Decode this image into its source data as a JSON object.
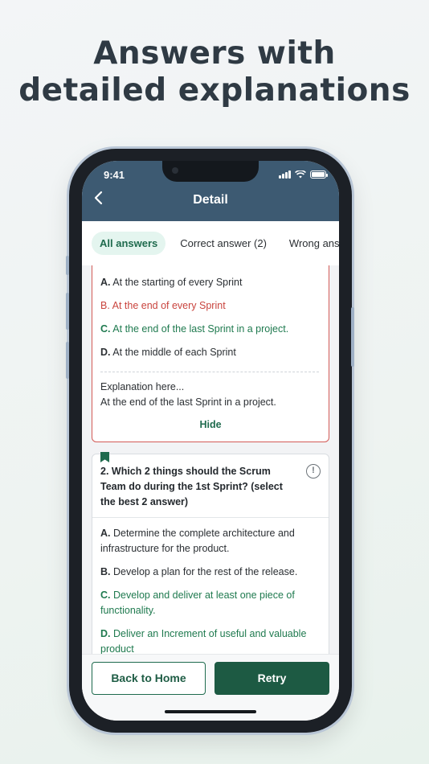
{
  "headline": {
    "line1": "Answers with",
    "line2": "detailed explanations"
  },
  "status_bar": {
    "time": "9:41"
  },
  "nav": {
    "title": "Detail",
    "back_icon": "chevron-left-icon"
  },
  "tabs": [
    {
      "label": "All answers",
      "active": true
    },
    {
      "label": "Correct answer (2)",
      "active": false
    },
    {
      "label": "Wrong answer",
      "active": false
    }
  ],
  "question1": {
    "options": [
      {
        "letter": "A.",
        "text": "At the starting of every Sprint",
        "state": "neutral"
      },
      {
        "letter": "B.",
        "text": "At the end of every Sprint",
        "state": "wrong"
      },
      {
        "letter": "C.",
        "text": "At the end of the last Sprint in a project.",
        "state": "correct"
      },
      {
        "letter": "D.",
        "text": "At the middle of each Sprint",
        "state": "neutral"
      }
    ],
    "explanation_title": "Explanation here...",
    "explanation_text": "At the end of the last Sprint in a project.",
    "hide_label": "Hide"
  },
  "question2": {
    "text": "2. Which 2 things should the Scrum Team do during the 1st Sprint? (select the best 2 answer)",
    "info_icon": "!",
    "options": [
      {
        "letter": "A.",
        "text": "Determine the complete architecture and infrastructure for the product.",
        "state": "neutral"
      },
      {
        "letter": "B.",
        "text": "Develop a plan for the rest of the release.",
        "state": "neutral"
      },
      {
        "letter": "C.",
        "text": "Develop and deliver at least one piece of functionality.",
        "state": "correct"
      },
      {
        "letter": "D.",
        "text": "Deliver an Increment of useful and valuable product",
        "state": "correct"
      }
    ]
  },
  "footer": {
    "back_home_label": "Back to Home",
    "retry_label": "Retry"
  },
  "colors": {
    "header": "#3d5a72",
    "accent_green": "#1d5a43",
    "wrong_red": "#c9443e",
    "correct_green": "#1f7a4f"
  }
}
